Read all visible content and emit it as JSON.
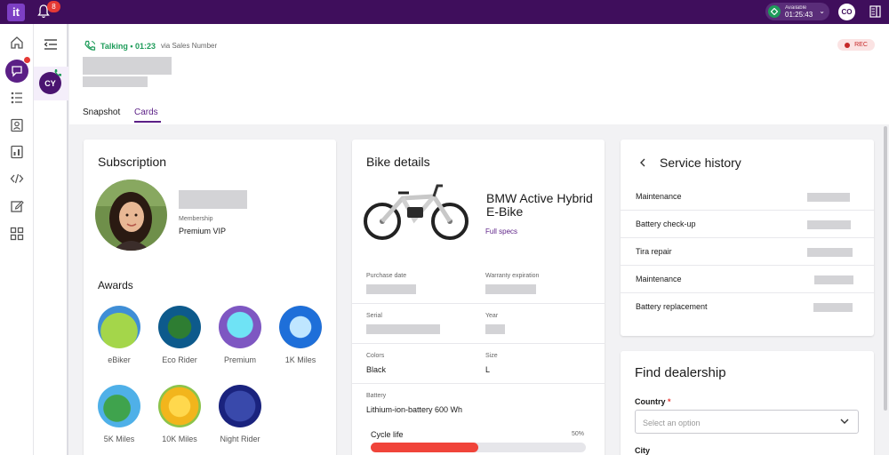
{
  "topbar": {
    "logo_text": "it",
    "notification_count": "8",
    "status_label": "Available",
    "status_timer": "01:25:43",
    "user_initials": "CO"
  },
  "conversation": {
    "avatar_initials": "CY"
  },
  "call": {
    "status": "Talking • 01:23",
    "via": "via Sales Number",
    "rec_label": "REC"
  },
  "tabs": [
    {
      "label": "Snapshot",
      "active": false
    },
    {
      "label": "Cards",
      "active": true
    }
  ],
  "subscription": {
    "title": "Subscription",
    "membership_label": "Membership",
    "membership_value": "Premium VIP",
    "awards_title": "Awards",
    "awards": [
      {
        "label": "eBiker",
        "color": "#3f8ed6"
      },
      {
        "label": "Eco Rider",
        "color": "#0d5a8c"
      },
      {
        "label": "Premium",
        "color": "#7e57c2"
      },
      {
        "label": "1K Miles",
        "color": "#1e6fd9"
      },
      {
        "label": "5K Miles",
        "color": "#4fb0e8"
      },
      {
        "label": "10K Miles",
        "color": "#8bc34a"
      },
      {
        "label": "Night Rider",
        "color": "#1a237e"
      }
    ]
  },
  "bike": {
    "title": "Bike details",
    "model": "BMW Active Hybrid E-Bike",
    "full_specs": "Full specs",
    "purchase_date_label": "Purchase date",
    "warranty_label": "Warranty expiration",
    "serial_label": "Serial",
    "year_label": "Year",
    "colors_label": "Colors",
    "colors_value": "Black",
    "size_label": "Size",
    "size_value": "L",
    "battery_label": "Battery",
    "battery_value": "Lithium-ion-battery 600 Wh",
    "cycle_life_label": "Cycle life",
    "cycle_life_percent": "50%",
    "cycle_life_fraction": 0.5
  },
  "service_history": {
    "title": "Service history",
    "items": [
      "Maintenance",
      "Battery check-up",
      "Tira repair",
      "Maintenance",
      "Battery replacement"
    ]
  },
  "dealership": {
    "title": "Find dealership",
    "country_label": "Country",
    "required_mark": "*",
    "country_placeholder": "Select an option",
    "city_label": "City"
  },
  "colors": {
    "brand": "#3f0e5c",
    "accent": "#5b1f86",
    "talking": "#1e9c5a",
    "progress": "#f0443a"
  }
}
